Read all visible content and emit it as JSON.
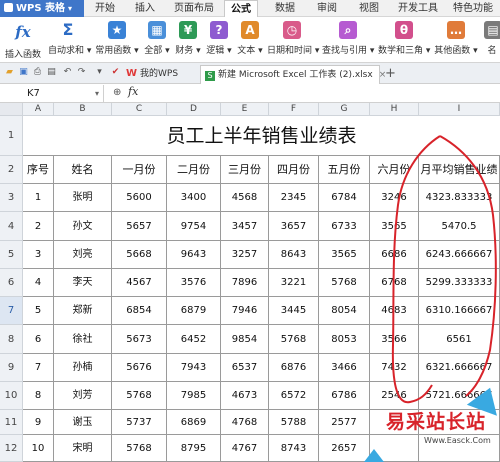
{
  "app": {
    "name": "WPS 表格"
  },
  "tabs": [
    "开始",
    "插入",
    "页面布局",
    "公式",
    "数据",
    "审阅",
    "视图",
    "开发工具",
    "特色功能"
  ],
  "active_tab": "公式",
  "ribbon": [
    {
      "label": "插入函数",
      "icon": "fx-icon",
      "glyph": "fx"
    },
    {
      "label": "自动求和 ▾",
      "icon": "sum-icon",
      "glyph": "Σ",
      "color": "#2c6bc4"
    },
    {
      "label": "常用函数 ▾",
      "icon": "star-icon",
      "glyph": "★",
      "color": "#3a82d6"
    },
    {
      "label": "全部 ▾",
      "icon": "all-functions-icon",
      "glyph": "▦",
      "color": "#4a8fd9"
    },
    {
      "label": "财务 ▾",
      "icon": "finance-icon",
      "glyph": "¥",
      "color": "#2e9a57"
    },
    {
      "label": "逻辑 ▾",
      "icon": "logic-icon",
      "glyph": "?",
      "color": "#8e5bd0"
    },
    {
      "label": "文本 ▾",
      "icon": "text-icon",
      "glyph": "A",
      "color": "#e08a2b"
    },
    {
      "label": "日期和时间 ▾",
      "icon": "clock-icon",
      "glyph": "◷",
      "color": "#d95b8a"
    },
    {
      "label": "查找与引用 ▾",
      "icon": "lookup-icon",
      "glyph": "⌕",
      "color": "#b65bd1"
    },
    {
      "label": "数学和三角 ▾",
      "icon": "math-icon",
      "glyph": "θ",
      "color": "#d24f8c"
    },
    {
      "label": "其他函数 ▾",
      "icon": "more-functions-icon",
      "glyph": "…",
      "color": "#e07b3a"
    },
    {
      "label": "名",
      "icon": "name-manager-icon",
      "glyph": "▤",
      "color": "#7a7a7a"
    }
  ],
  "doc_tabs": [
    {
      "label": "我的WPS",
      "icon": "wps-logo-icon"
    },
    {
      "label": "新建 Microsoft Excel 工作表 (2).xlsx",
      "icon": "excel-file-icon"
    }
  ],
  "formula_bar": {
    "cell_ref": "K7",
    "fx": "fx",
    "value": ""
  },
  "columns": [
    "A",
    "B",
    "C",
    "D",
    "E",
    "F",
    "G",
    "H",
    "I"
  ],
  "rows": [
    "1",
    "2",
    "3",
    "4",
    "5",
    "6",
    "7",
    "8",
    "9",
    "10",
    "11",
    "12"
  ],
  "selected_row": "7",
  "sheet": {
    "title": "员工上半年销售业绩表",
    "headers": [
      "序号",
      "姓名",
      "一月份",
      "二月份",
      "三月份",
      "四月份",
      "五月份",
      "六月份",
      "月平均销售业绩"
    ],
    "data": [
      [
        "1",
        "张明",
        "5600",
        "3400",
        "4568",
        "2345",
        "6784",
        "3246",
        "4323.833333"
      ],
      [
        "2",
        "孙文",
        "5657",
        "9754",
        "3457",
        "3657",
        "6733",
        "3565",
        "5470.5"
      ],
      [
        "3",
        "刘亮",
        "5668",
        "9643",
        "3257",
        "8643",
        "3565",
        "6686",
        "6243.666667"
      ],
      [
        "4",
        "李天",
        "4567",
        "3576",
        "7896",
        "3221",
        "5768",
        "6768",
        "5299.333333"
      ],
      [
        "5",
        "郑新",
        "6854",
        "6879",
        "7946",
        "3445",
        "8054",
        "4683",
        "6310.166667"
      ],
      [
        "6",
        "徐社",
        "5673",
        "6452",
        "9854",
        "5768",
        "8053",
        "3566",
        "6561"
      ],
      [
        "7",
        "孙楠",
        "5676",
        "7943",
        "6537",
        "6876",
        "3466",
        "7432",
        "6321.666667"
      ],
      [
        "8",
        "刘芳",
        "5768",
        "7985",
        "4673",
        "6572",
        "6786",
        "2546",
        "5721.666667"
      ],
      [
        "9",
        "谢玉",
        "5737",
        "6869",
        "4768",
        "5788",
        "2577",
        "",
        ""
      ],
      [
        "10",
        "宋明",
        "5768",
        "8795",
        "4767",
        "8743",
        "2657",
        "",
        ""
      ]
    ]
  },
  "watermark": {
    "text": "易采站长站",
    "url": "Www.Easck.Com"
  },
  "colors": {
    "app_blue": "#3f76c9",
    "annotation_red": "#d8232a",
    "grid": "#9a9a9a"
  }
}
